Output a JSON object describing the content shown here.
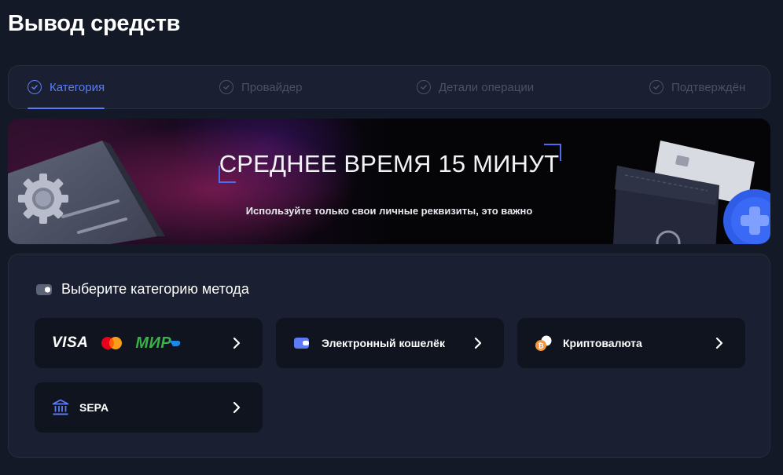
{
  "page": {
    "title": "Вывод средств"
  },
  "stepper": {
    "steps": [
      {
        "label": "Категория",
        "active": true
      },
      {
        "label": "Провайдер",
        "active": false
      },
      {
        "label": "Детали операции",
        "active": false
      },
      {
        "label": "Подтверждён",
        "active": false
      }
    ]
  },
  "banner": {
    "title": "СРЕДНЕЕ ВРЕМЯ 15 МИНУТ",
    "subtitle": "Используйте только свои личные реквизиты, это важно"
  },
  "methods": {
    "header": "Выберите категорию метода",
    "cards": [
      {
        "id": "cards",
        "brands": [
          "VISA",
          "МИР"
        ],
        "icons": [
          "visa-logo",
          "mastercard-logo",
          "mir-logo"
        ]
      },
      {
        "id": "ewallet",
        "label": "Электронный кошелёк",
        "icon": "wallet-icon"
      },
      {
        "id": "crypto",
        "label": "Криптовалюта",
        "icon": "crypto-coins-icon"
      },
      {
        "id": "sepa",
        "label": "SEPA",
        "icon": "bank-icon"
      }
    ]
  },
  "colors": {
    "background": "#141927",
    "panel": "#1a2031",
    "card": "#10141f",
    "accent": "#5b7cf6",
    "muted": "#4a5166"
  }
}
